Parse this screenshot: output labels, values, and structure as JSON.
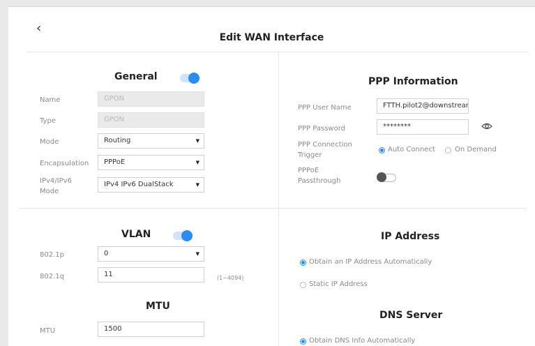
{
  "header": {
    "back_glyph": "‹",
    "title": "Edit WAN Interface"
  },
  "general": {
    "title": "General",
    "enabled": true,
    "name_label": "Name",
    "name_value": "GPON",
    "type_label": "Type",
    "type_value": "GPON",
    "mode_label": "Mode",
    "mode_value": "Routing",
    "encap_label": "Encapsulation",
    "encap_value": "PPPoE",
    "ipv_label_1": "IPv4/IPv6",
    "ipv_label_2": "Mode",
    "ipv_value": "IPv4 IPv6 DualStack"
  },
  "ppp": {
    "title": "PPP Information",
    "user_label": "PPP User Name",
    "user_value": "FTTH.pilot2@downstrean",
    "pass_label": "PPP Password",
    "pass_value": "********",
    "trigger_label_1": "PPP Connection",
    "trigger_label_2": "Trigger",
    "auto_label": "Auto Connect",
    "demand_label": "On Demand",
    "passthrough_label_1": "PPPoE",
    "passthrough_label_2": "Passthrough",
    "passthrough_enabled": false
  },
  "vlan": {
    "title": "VLAN",
    "enabled": true,
    "p_label": "802.1p",
    "p_value": "0",
    "q_label": "802.1q",
    "q_value": "11",
    "q_hint": "(1~4094)"
  },
  "mtu": {
    "title": "MTU",
    "label": "MTU",
    "value": "1500"
  },
  "ip": {
    "title": "IP Address",
    "auto_label": "Obtain an IP Address Automatically",
    "static_label": "Static IP Address",
    "selected": "auto"
  },
  "dns": {
    "title": "DNS Server",
    "auto_label": "Obtain DNS Info Automatically"
  },
  "colors": {
    "accent": "#2d8cf0",
    "toggle_track": "#cfe3fb"
  }
}
